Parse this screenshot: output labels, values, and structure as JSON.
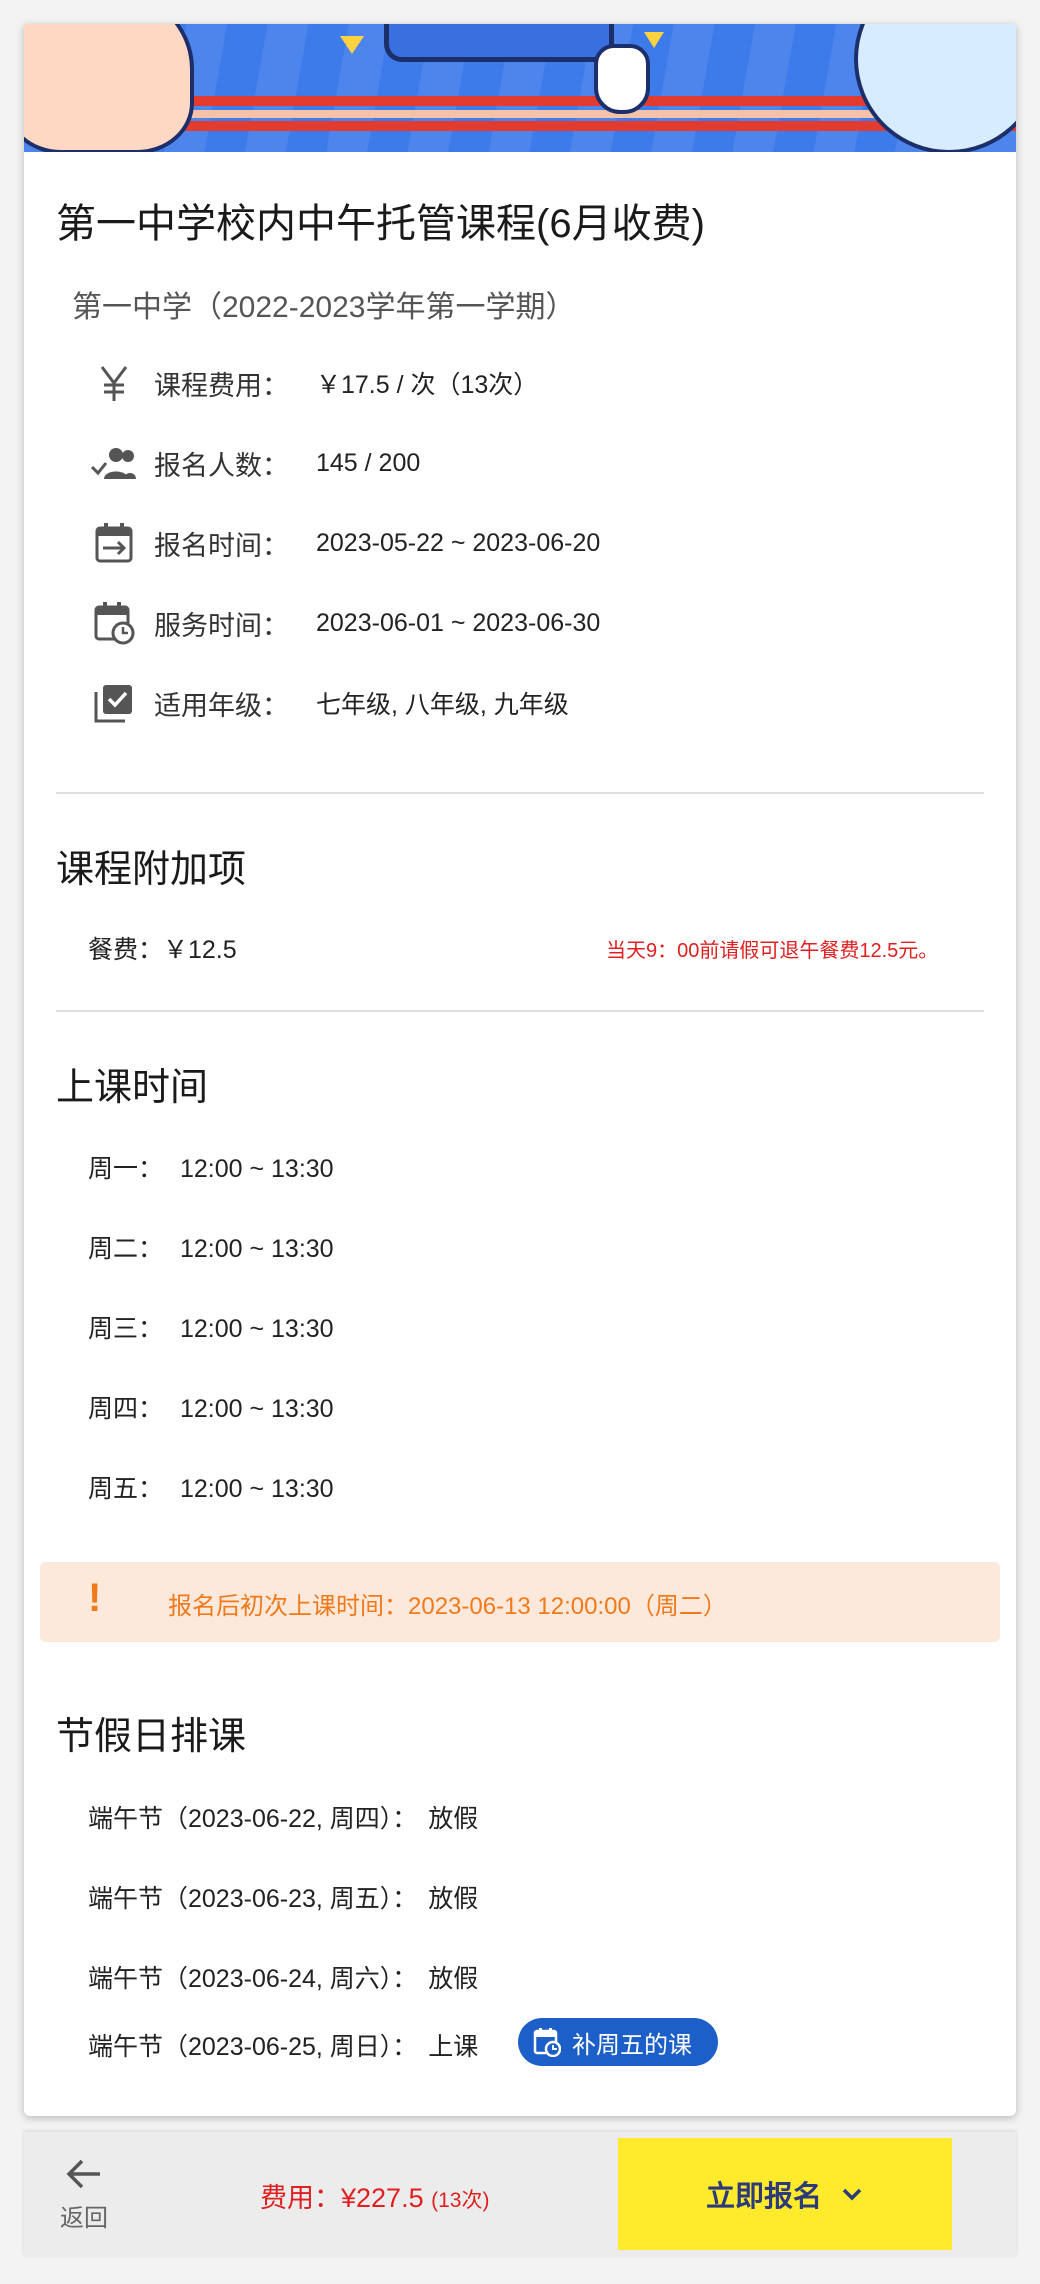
{
  "course": {
    "title": "第一中学校内中午托管课程(6月收费)",
    "subtitle": "第一中学（2022-2023学年第一学期）"
  },
  "info_rows": [
    {
      "icon": "yuan-icon",
      "label": "课程费用：",
      "value": "￥17.5 / 次（13次）"
    },
    {
      "icon": "people-check-icon",
      "label": "报名人数：",
      "value": "145 / 200"
    },
    {
      "icon": "calendar-arrow-icon",
      "label": "报名时间：",
      "value": "2023-05-22 ~ 2023-06-20"
    },
    {
      "icon": "calendar-clock-icon",
      "label": "服务时间：",
      "value": "2023-06-01 ~ 2023-06-30"
    },
    {
      "icon": "checkbox-stack-icon",
      "label": "适用年级：",
      "value": "七年级, 八年级, 九年级"
    }
  ],
  "addons": {
    "title": "课程附加项",
    "meal": "餐费：￥12.5",
    "note": "当天9：00前请假可退午餐费12.5元。"
  },
  "schedule": {
    "title": "上课时间",
    "rows": [
      {
        "day": "周一：",
        "time": "12:00 ~ 13:30"
      },
      {
        "day": "周二：",
        "time": "12:00 ~ 13:30"
      },
      {
        "day": "周三：",
        "time": "12:00 ~ 13:30"
      },
      {
        "day": "周四：",
        "time": "12:00 ~ 13:30"
      },
      {
        "day": "周五：",
        "time": "12:00 ~ 13:30"
      }
    ]
  },
  "alert": {
    "icon": "!",
    "text": "报名后初次上课时间：2023-06-13 12:00:00（周二）"
  },
  "holidays": {
    "title": "节假日排课",
    "rows": [
      {
        "name": "端午节（2023-06-22, 周四）：",
        "status": "放假"
      },
      {
        "name": "端午节（2023-06-23, 周五）：",
        "status": "放假"
      },
      {
        "name": "端午节（2023-06-24, 周六）：",
        "status": "放假"
      },
      {
        "name": "端午节（2023-06-25, 周日）：",
        "status": "上课"
      }
    ],
    "makeup_chip": "补周五的课"
  },
  "bottom_bar": {
    "back_label": "返回",
    "fee_label": "费用：¥227.5",
    "fee_count": "(13次)",
    "enroll_label": "立即报名"
  },
  "colors": {
    "accent_blue": "#1d5fc9",
    "enroll_yellow": "#ffeb2c",
    "price_red": "#e02020",
    "alert_orange": "#f07a1a",
    "alert_bg": "#fde8dc"
  }
}
